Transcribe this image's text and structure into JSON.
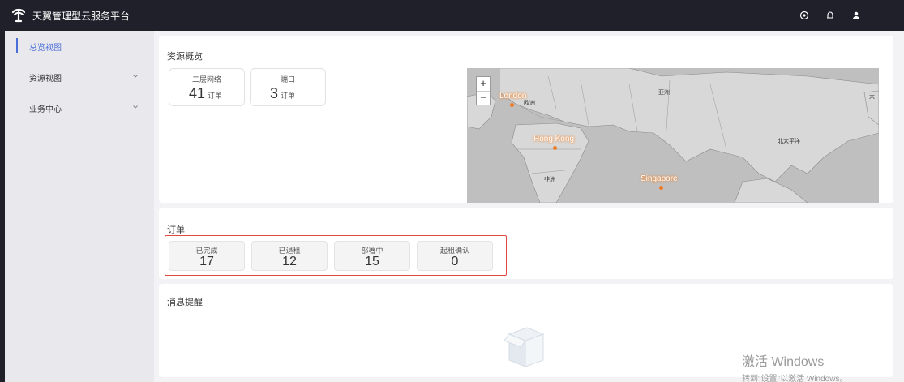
{
  "header": {
    "title": "天翼管理型云服务平台",
    "logo_icon": "telecom-logo-icon",
    "bg": "#1f2029"
  },
  "header_icons": [
    "settings-icon",
    "bell-icon",
    "user-icon"
  ],
  "sidebar": {
    "items": [
      {
        "label": "总览视图",
        "active": true
      },
      {
        "label": "资源视图",
        "expandable": true
      },
      {
        "label": "业务中心",
        "expandable": true
      }
    ]
  },
  "resources": {
    "title": "资源概览",
    "stats": [
      {
        "label": "二层网络",
        "value": "41",
        "unit": "订单"
      },
      {
        "label": "端口",
        "value": "3",
        "unit": "订单"
      }
    ],
    "map": {
      "zoom_in": "+",
      "zoom_out": "−",
      "cities": [
        "London",
        "Hong Kong",
        "Singapore"
      ],
      "region_labels": [
        "欧洲",
        "亚洲",
        "北太平洋",
        "非洲",
        "大"
      ]
    }
  },
  "orders": {
    "title": "订单",
    "highlight_color": "#e2463d",
    "stats": [
      {
        "label": "已完成",
        "value": "17"
      },
      {
        "label": "已退租",
        "value": "12"
      },
      {
        "label": "部署中",
        "value": "15"
      },
      {
        "label": "起租确认",
        "value": "0"
      }
    ]
  },
  "messages": {
    "title": "消息提醒",
    "empty_icon": "empty-box-icon"
  },
  "watermark": {
    "line1": "激活 Windows",
    "line2": "转到\"设置\"以激活 Windows。"
  },
  "colors": {
    "accent": "#4a6ed8",
    "map_marker": "#f07a24"
  }
}
